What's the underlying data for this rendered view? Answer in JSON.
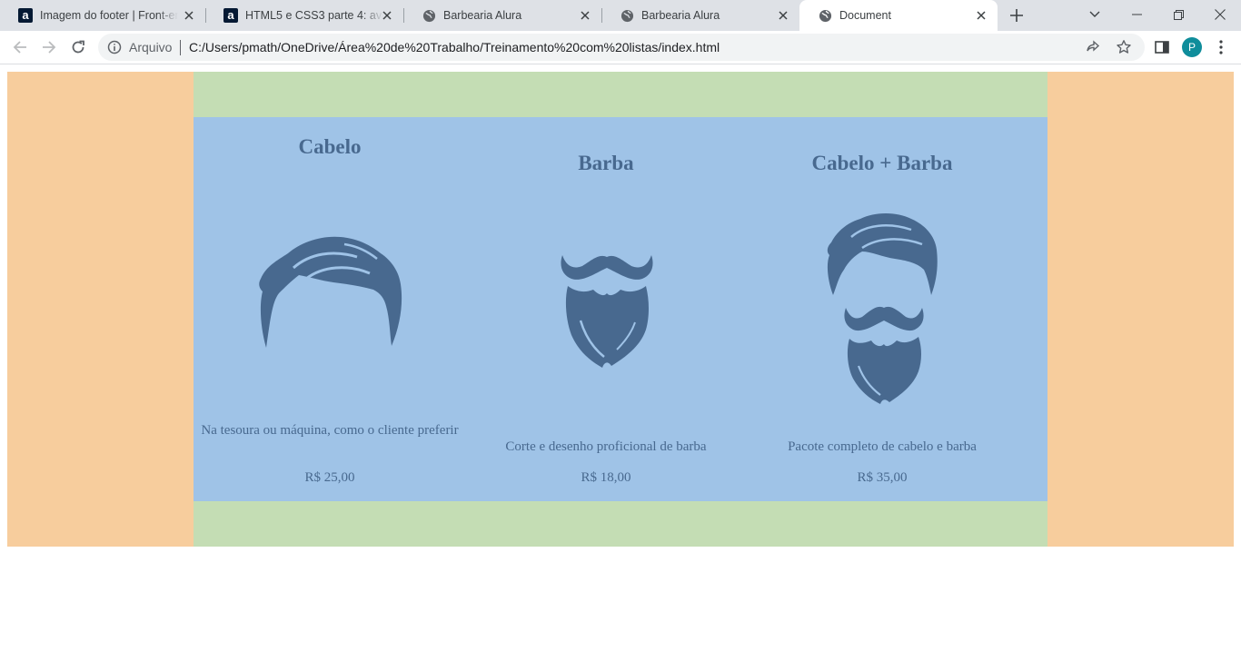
{
  "browser": {
    "tabs": [
      {
        "title": "Imagem do footer | Front-end",
        "favicon": "alura-icon"
      },
      {
        "title": "HTML5 e CSS3 parte 4: avançando",
        "favicon": "alura-icon"
      },
      {
        "title": "Barbearia Alura",
        "favicon": "globe-icon"
      },
      {
        "title": "Barbearia Alura",
        "favicon": "globe-icon"
      },
      {
        "title": "Document",
        "favicon": "globe-icon",
        "active": true
      }
    ],
    "omnibox": {
      "scheme_label": "Arquivo",
      "url": "C:/Users/pmath/OneDrive/Área%20de%20Trabalho/Treinamento%20com%20listas/index.html"
    },
    "profile_initial": "P",
    "colors": {
      "accent": "#0f8d9b",
      "tabstrip": "#dee1e6"
    }
  },
  "page": {
    "colors": {
      "outer": "#f7cd9d",
      "green": "#c4ddb4",
      "blue": "#9fc3e7",
      "text": "#48698f"
    },
    "products": [
      {
        "title": "Cabelo",
        "image": "hair-icon",
        "description": "Na tesoura ou máquina, como o cliente preferir",
        "price": "R$ 25,00"
      },
      {
        "title": "Barba",
        "image": "beard-icon",
        "description": "Corte e desenho proficional de barba",
        "price": "R$ 18,00"
      },
      {
        "title": "Cabelo + Barba",
        "image": "hair-and-beard-icon",
        "description": "Pacote completo de cabelo e barba",
        "price": "R$ 35,00"
      }
    ]
  }
}
